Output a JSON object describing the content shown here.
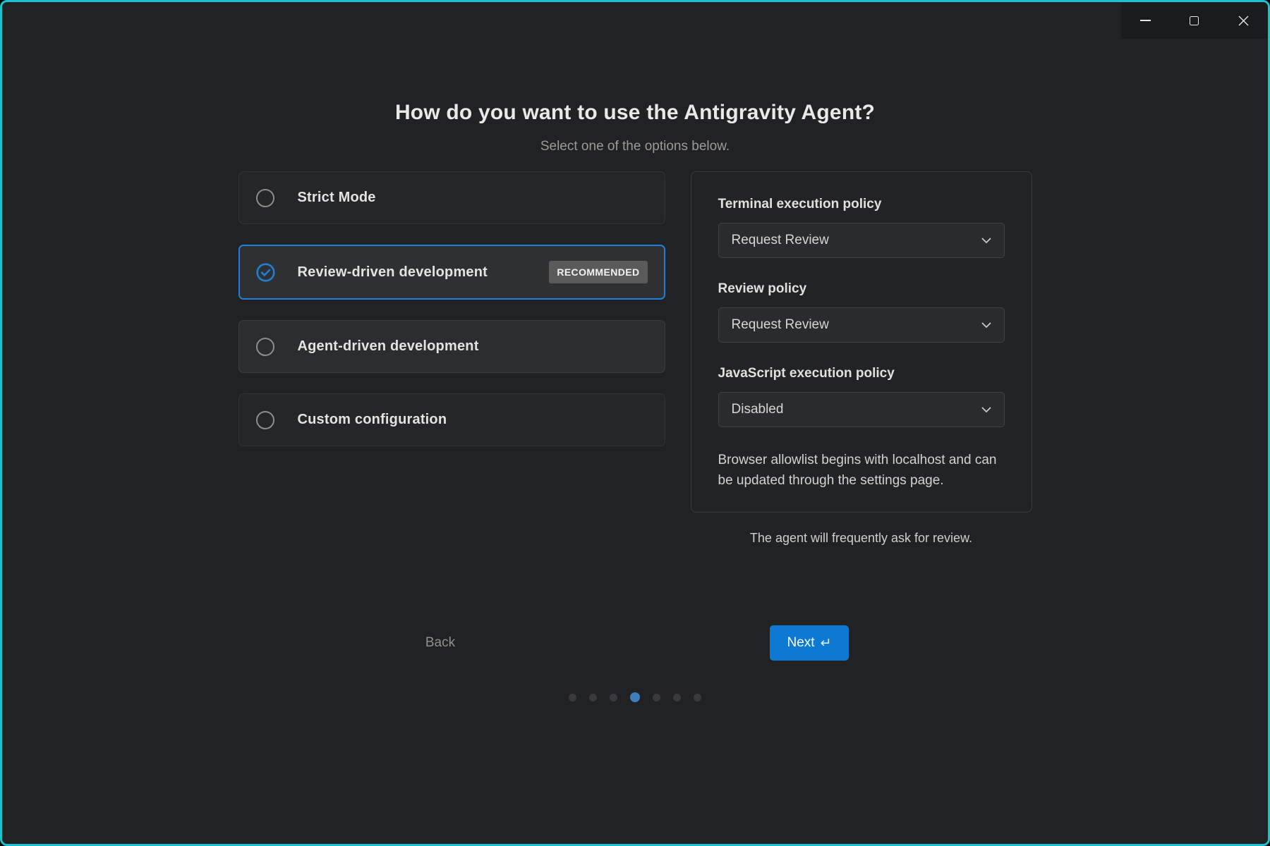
{
  "window": {
    "controls": [
      {
        "name": "minimize"
      },
      {
        "name": "maximize"
      },
      {
        "name": "close"
      }
    ]
  },
  "header": {
    "title": "How do you want to use the Antigravity Agent?",
    "subtitle": "Select one of the options below."
  },
  "options": [
    {
      "label": "Strict Mode",
      "selected": false,
      "badge": ""
    },
    {
      "label": "Review-driven development",
      "selected": true,
      "badge": "RECOMMENDED"
    },
    {
      "label": "Agent-driven development",
      "selected": false,
      "badge": ""
    },
    {
      "label": "Custom configuration",
      "selected": false,
      "badge": ""
    }
  ],
  "policy_panel": {
    "fields": [
      {
        "label": "Terminal execution policy",
        "value": "Request Review"
      },
      {
        "label": "Review policy",
        "value": "Request Review"
      },
      {
        "label": "JavaScript execution policy",
        "value": "Disabled"
      }
    ],
    "note": "Browser allowlist begins with localhost and can be updated through the settings page."
  },
  "hint": "The agent will frequently ask for review.",
  "footer": {
    "back_label": "Back",
    "next_label": "Next",
    "next_icon": "↵"
  },
  "progress": {
    "total": 7,
    "active_index": 3
  },
  "colors": {
    "window_border": "#17c3cf",
    "accent_blue": "#0e79d2",
    "selected_border": "#1e7fd6",
    "progress_active": "#3f7ebe"
  }
}
